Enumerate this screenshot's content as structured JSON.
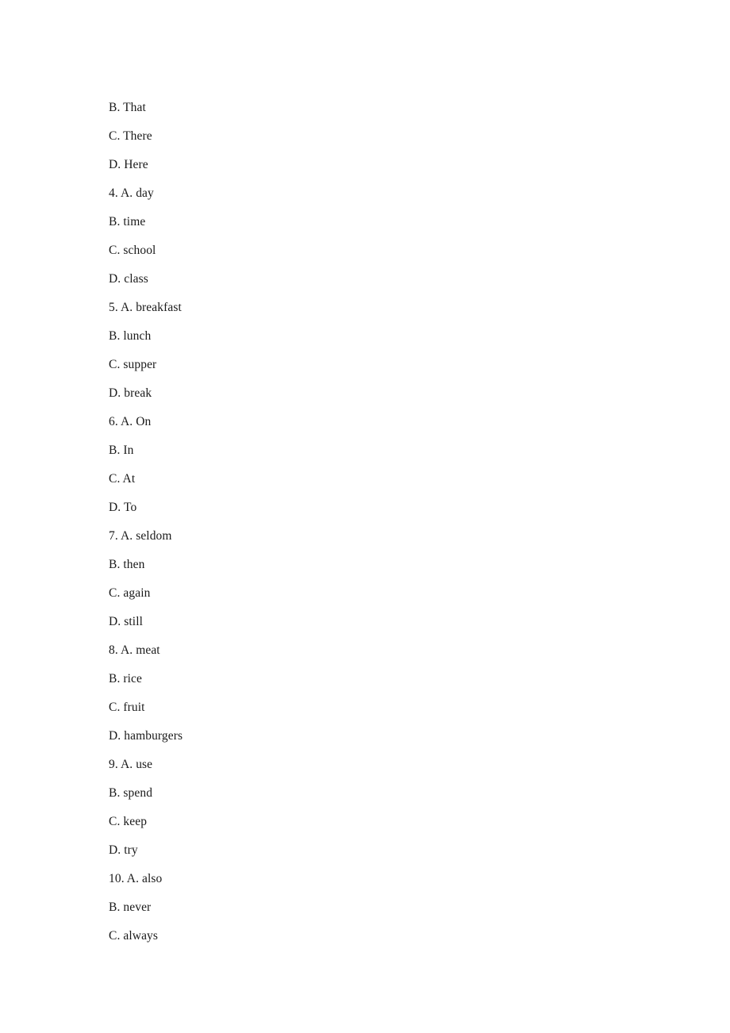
{
  "document": {
    "page_background": "#ffffff",
    "text_color": "#1a1a1a",
    "content_type": "multiple-choice-options-list"
  },
  "options": {
    "lines": [
      {
        "index": 0,
        "text": "B. That",
        "question": null,
        "letter": "B",
        "value": "That"
      },
      {
        "index": 1,
        "text": "C. There",
        "question": null,
        "letter": "C",
        "value": "There"
      },
      {
        "index": 2,
        "text": "D. Here",
        "question": null,
        "letter": "D",
        "value": "Here"
      },
      {
        "index": 3,
        "text": "4. A. day",
        "question": "4",
        "letter": "A",
        "value": "day"
      },
      {
        "index": 4,
        "text": "B. time",
        "question": null,
        "letter": "B",
        "value": "time"
      },
      {
        "index": 5,
        "text": "C. school",
        "question": null,
        "letter": "C",
        "value": "school"
      },
      {
        "index": 6,
        "text": "D. class",
        "question": null,
        "letter": "D",
        "value": "class"
      },
      {
        "index": 7,
        "text": "5. A. breakfast",
        "question": "5",
        "letter": "A",
        "value": "breakfast"
      },
      {
        "index": 8,
        "text": "B. lunch",
        "question": null,
        "letter": "B",
        "value": "lunch"
      },
      {
        "index": 9,
        "text": "C. supper",
        "question": null,
        "letter": "C",
        "value": "supper"
      },
      {
        "index": 10,
        "text": "D. break",
        "question": null,
        "letter": "D",
        "value": "break"
      },
      {
        "index": 11,
        "text": "6. A. On",
        "question": "6",
        "letter": "A",
        "value": "On"
      },
      {
        "index": 12,
        "text": "B. In",
        "question": null,
        "letter": "B",
        "value": "In"
      },
      {
        "index": 13,
        "text": "C. At",
        "question": null,
        "letter": "C",
        "value": "At"
      },
      {
        "index": 14,
        "text": "D. To",
        "question": null,
        "letter": "D",
        "value": "To"
      },
      {
        "index": 15,
        "text": "7. A. seldom",
        "question": "7",
        "letter": "A",
        "value": "seldom"
      },
      {
        "index": 16,
        "text": "B. then",
        "question": null,
        "letter": "B",
        "value": "then"
      },
      {
        "index": 17,
        "text": "C. again",
        "question": null,
        "letter": "C",
        "value": "again"
      },
      {
        "index": 18,
        "text": "D. still",
        "question": null,
        "letter": "D",
        "value": "still"
      },
      {
        "index": 19,
        "text": "8. A. meat",
        "question": "8",
        "letter": "A",
        "value": "meat"
      },
      {
        "index": 20,
        "text": "B. rice",
        "question": null,
        "letter": "B",
        "value": "rice"
      },
      {
        "index": 21,
        "text": "C. fruit",
        "question": null,
        "letter": "C",
        "value": "fruit"
      },
      {
        "index": 22,
        "text": "D. hamburgers",
        "question": null,
        "letter": "D",
        "value": "hamburgers"
      },
      {
        "index": 23,
        "text": "9. A. use",
        "question": "9",
        "letter": "A",
        "value": "use"
      },
      {
        "index": 24,
        "text": "B. spend",
        "question": null,
        "letter": "B",
        "value": "spend"
      },
      {
        "index": 25,
        "text": "C. keep",
        "question": null,
        "letter": "C",
        "value": "keep"
      },
      {
        "index": 26,
        "text": "D. try",
        "question": null,
        "letter": "D",
        "value": "try"
      },
      {
        "index": 27,
        "text": "10. A. also",
        "question": "10",
        "letter": "A",
        "value": "also"
      },
      {
        "index": 28,
        "text": "B. never",
        "question": null,
        "letter": "B",
        "value": "never"
      },
      {
        "index": 29,
        "text": "C. always",
        "question": null,
        "letter": "C",
        "value": "always"
      }
    ]
  }
}
